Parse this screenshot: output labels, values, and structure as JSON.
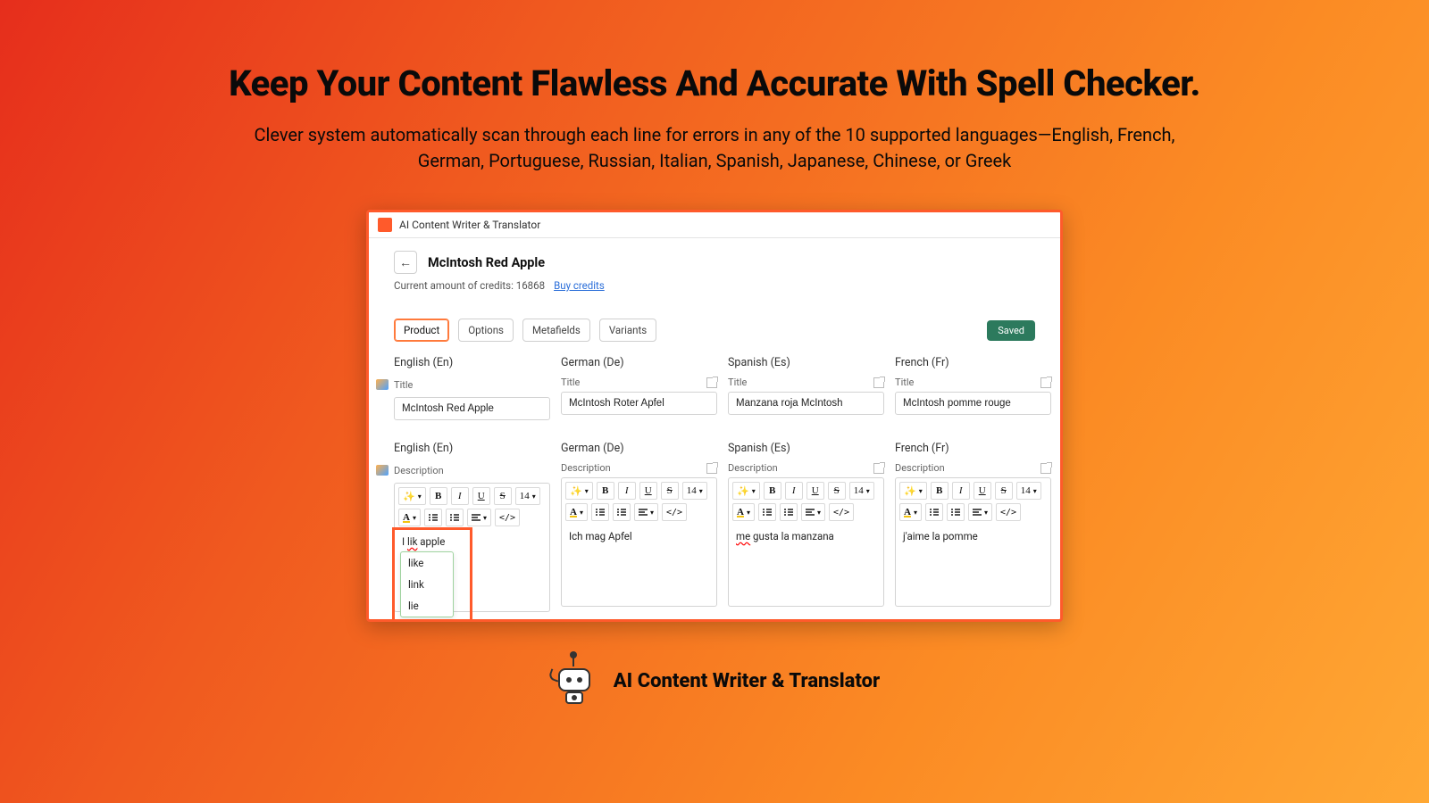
{
  "hero": {
    "title": "Keep Your Content Flawless And Accurate With Spell Checker.",
    "subtitle": "Clever system automatically scan through each line for errors in any of the 10 supported languages—English, French, German, Portuguese, Russian, Italian, Spanish, Japanese, Chinese, or Greek"
  },
  "app": {
    "window_title": "AI Content Writer & Translator",
    "breadcrumb": "McIntosh Red Apple",
    "credits_label": "Current amount of credits:",
    "credits_value": "16868",
    "buy_link": "Buy credits",
    "tabs": [
      "Product",
      "Options",
      "Metafields",
      "Variants"
    ],
    "active_tab": 0,
    "saved_badge": "Saved",
    "field_title_label": "Title",
    "field_desc_label": "Description",
    "font_size": "14",
    "columns": [
      {
        "lang": "English (En)",
        "title": "McIntosh Red Apple",
        "desc_prefix": "I ",
        "desc_error": "lik",
        "desc_suffix": " apple",
        "suggestions": [
          "like",
          "link",
          "lie"
        ],
        "has_spell_popup": true
      },
      {
        "lang": "German (De)",
        "title": "McIntosh Roter Apfel",
        "desc": "Ich mag Apfel"
      },
      {
        "lang": "Spanish (Es)",
        "title": "Manzana roja McIntosh",
        "desc_error": "me",
        "desc_suffix": " gusta la manzana"
      },
      {
        "lang": "French (Fr)",
        "title": "McIntosh pomme rouge",
        "desc": "j'aime la pomme"
      }
    ]
  },
  "footer": {
    "brand": "AI Content Writer & Translator"
  }
}
